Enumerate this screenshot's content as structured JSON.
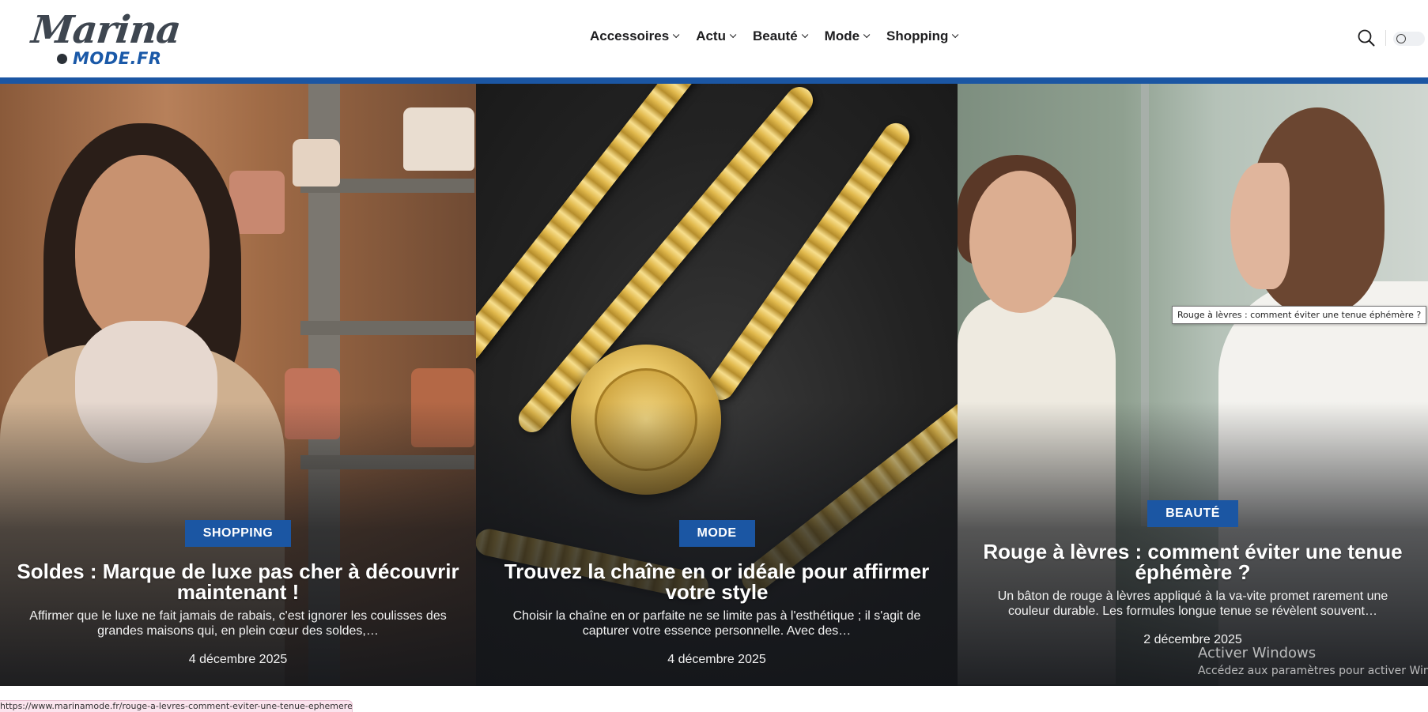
{
  "logo": {
    "script": "Marina",
    "sub": "MODE.FR"
  },
  "nav": {
    "items": [
      {
        "label": "Accessoires"
      },
      {
        "label": "Actu"
      },
      {
        "label": "Beauté"
      },
      {
        "label": "Mode"
      },
      {
        "label": "Shopping"
      }
    ]
  },
  "colors": {
    "brand_blue": "#1b56a3",
    "logo_grey": "#3e4650"
  },
  "cards": [
    {
      "category": "SHOPPING",
      "title": "Soldes : Marque de luxe pas cher à découvrir maintenant !",
      "excerpt": "Affirmer que le luxe ne fait jamais de rabais, c'est ignorer les coulisses des grandes maisons qui, en plein cœur des soldes,…",
      "date": "4 décembre 2025"
    },
    {
      "category": "MODE",
      "title": "Trouvez la chaîne en or idéale pour affirmer votre style",
      "excerpt": "Choisir la chaîne en or parfaite ne se limite pas à l'esthétique ; il s'agit de capturer votre essence personnelle. Avec des…",
      "date": "4 décembre 2025"
    },
    {
      "category": "BEAUTÉ",
      "title": "Rouge à lèvres : comment éviter une tenue éphémère ?",
      "excerpt": "Un bâton de rouge à lèvres appliqué à la va-vite promet rarement une couleur durable. Les formules longue tenue se révèlent souvent…",
      "date": "2 décembre 2025"
    }
  ],
  "tooltip": "Rouge à lèvres : comment éviter une tenue éphémère ?",
  "windows_activation": {
    "title": "Activer Windows",
    "subtitle": "Accédez aux paramètres pour activer Windo"
  },
  "status_url": "https://www.marinamode.fr/rouge-a-levres-comment-eviter-une-tenue-ephemere/"
}
